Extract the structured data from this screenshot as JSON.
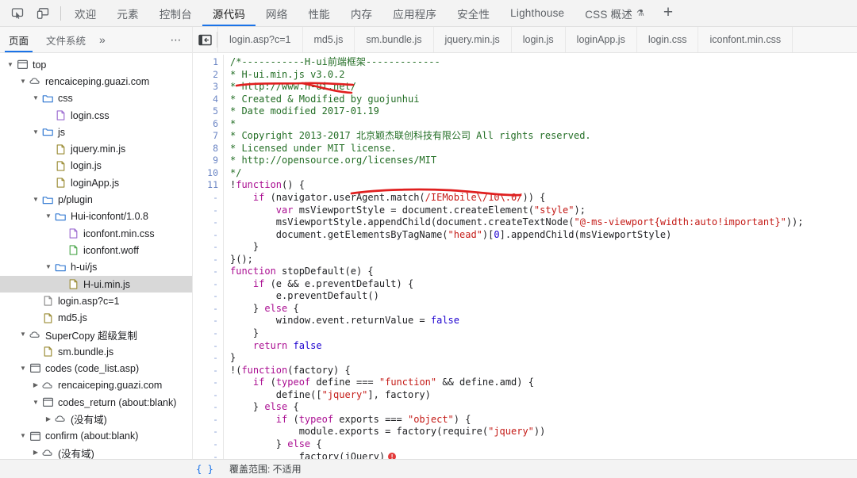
{
  "topbar": {
    "icons": [
      {
        "name": "inspect-element-icon",
        "title": "检查"
      },
      {
        "name": "device-toolbar-icon",
        "title": "设备工具栏"
      }
    ],
    "tabs": [
      {
        "label": "欢迎",
        "active": false,
        "flask": false
      },
      {
        "label": "元素",
        "active": false,
        "flask": false
      },
      {
        "label": "控制台",
        "active": false,
        "flask": false
      },
      {
        "label": "源代码",
        "active": true,
        "flask": false
      },
      {
        "label": "网络",
        "active": false,
        "flask": false
      },
      {
        "label": "性能",
        "active": false,
        "flask": false
      },
      {
        "label": "内存",
        "active": false,
        "flask": false
      },
      {
        "label": "应用程序",
        "active": false,
        "flask": false
      },
      {
        "label": "安全性",
        "active": false,
        "flask": false
      },
      {
        "label": "Lighthouse",
        "active": false,
        "flask": false
      },
      {
        "label": "CSS 概述",
        "active": false,
        "flask": true
      }
    ],
    "add_tab_label": "+"
  },
  "navigator": {
    "tabs": [
      {
        "label": "页面",
        "active": true
      },
      {
        "label": "文件系统",
        "active": false
      }
    ],
    "more_tabs_label": "»",
    "options_label": "⋯",
    "tree": [
      {
        "depth": 0,
        "twisty": "down",
        "icon": "frame-icon",
        "label": "top",
        "selected": false
      },
      {
        "depth": 1,
        "twisty": "down",
        "icon": "cloud-icon",
        "label": "rencaiceping.guazi.com",
        "selected": false
      },
      {
        "depth": 2,
        "twisty": "down",
        "icon": "folder-icon",
        "label": "css",
        "selected": false
      },
      {
        "depth": 3,
        "twisty": "none",
        "icon": "file-css-icon",
        "label": "login.css",
        "selected": false
      },
      {
        "depth": 2,
        "twisty": "down",
        "icon": "folder-icon",
        "label": "js",
        "selected": false
      },
      {
        "depth": 3,
        "twisty": "none",
        "icon": "file-js-icon",
        "label": "jquery.min.js",
        "selected": false
      },
      {
        "depth": 3,
        "twisty": "none",
        "icon": "file-js-icon",
        "label": "login.js",
        "selected": false
      },
      {
        "depth": 3,
        "twisty": "none",
        "icon": "file-js-icon",
        "label": "loginApp.js",
        "selected": false
      },
      {
        "depth": 2,
        "twisty": "down",
        "icon": "folder-icon",
        "label": "p/plugin",
        "selected": false
      },
      {
        "depth": 3,
        "twisty": "down",
        "icon": "folder-icon",
        "label": "Hui-iconfont/1.0.8",
        "selected": false
      },
      {
        "depth": 4,
        "twisty": "none",
        "icon": "file-css-icon",
        "label": "iconfont.min.css",
        "selected": false
      },
      {
        "depth": 4,
        "twisty": "none",
        "icon": "file-font-icon",
        "label": "iconfont.woff",
        "selected": false
      },
      {
        "depth": 3,
        "twisty": "down",
        "icon": "folder-icon",
        "label": "h-ui/js",
        "selected": false
      },
      {
        "depth": 4,
        "twisty": "none",
        "icon": "file-js-icon",
        "label": "H-ui.min.js",
        "selected": true
      },
      {
        "depth": 2,
        "twisty": "none",
        "icon": "file-doc-icon",
        "label": "login.asp?c=1",
        "selected": false
      },
      {
        "depth": 2,
        "twisty": "none",
        "icon": "file-js-icon",
        "label": "md5.js",
        "selected": false
      },
      {
        "depth": 1,
        "twisty": "down",
        "icon": "cloud-icon",
        "label": "SuperCopy 超级复制",
        "selected": false
      },
      {
        "depth": 2,
        "twisty": "none",
        "icon": "file-js-icon",
        "label": "sm.bundle.js",
        "selected": false
      },
      {
        "depth": 1,
        "twisty": "down",
        "icon": "frame-icon",
        "label": "codes (code_list.asp)",
        "selected": false
      },
      {
        "depth": 2,
        "twisty": "right",
        "icon": "cloud-icon",
        "label": "rencaiceping.guazi.com",
        "selected": false
      },
      {
        "depth": 2,
        "twisty": "down",
        "icon": "frame-icon",
        "label": "codes_return (about:blank)",
        "selected": false
      },
      {
        "depth": 3,
        "twisty": "right",
        "icon": "cloud-icon",
        "label": "(没有域)",
        "selected": false
      },
      {
        "depth": 1,
        "twisty": "down",
        "icon": "frame-icon",
        "label": "confirm (about:blank)",
        "selected": false
      },
      {
        "depth": 2,
        "twisty": "right",
        "icon": "cloud-icon",
        "label": "(没有域)",
        "selected": false
      }
    ]
  },
  "editor": {
    "panel_toggle_name": "show-navigator-button",
    "tabs": [
      {
        "label": "login.asp?c=1",
        "active": false
      },
      {
        "label": "md5.js",
        "active": false
      },
      {
        "label": "sm.bundle.js",
        "active": false
      },
      {
        "label": "jquery.min.js",
        "active": false
      },
      {
        "label": "login.js",
        "active": false
      },
      {
        "label": "loginApp.js",
        "active": false
      },
      {
        "label": "login.css",
        "active": false
      },
      {
        "label": "iconfont.min.css",
        "active": false
      }
    ],
    "line_numbers": [
      "1",
      "2",
      "3",
      "4",
      "5",
      "6",
      "7",
      "8",
      "9",
      "10",
      "11",
      "-",
      "-",
      "-",
      "-",
      "-",
      "-",
      "-",
      "-",
      "-",
      "-",
      "-",
      "-",
      "-",
      "-",
      "-",
      "-",
      "-",
      "-",
      "-",
      "-",
      "-",
      "-",
      "-"
    ],
    "lines": [
      {
        "tokens": [
          {
            "t": "/*-----------H-ui前端框架-------------",
            "c": "c-com"
          }
        ]
      },
      {
        "tokens": [
          {
            "t": "* H-ui.min.js v3.0.2",
            "c": "c-com"
          }
        ]
      },
      {
        "tokens": [
          {
            "t": "* http://www.h-ui.net/",
            "c": "c-com"
          }
        ]
      },
      {
        "tokens": [
          {
            "t": "* Created & Modified by guojunhui",
            "c": "c-com"
          }
        ]
      },
      {
        "tokens": [
          {
            "t": "* Date modified 2017-01.19",
            "c": "c-com"
          }
        ]
      },
      {
        "tokens": [
          {
            "t": "*",
            "c": "c-com"
          }
        ]
      },
      {
        "tokens": [
          {
            "t": "* Copyright 2013-2017 北京颖杰联创科技有限公司 All rights reserved.",
            "c": "c-com"
          }
        ]
      },
      {
        "tokens": [
          {
            "t": "* Licensed under MIT license.",
            "c": "c-com"
          }
        ]
      },
      {
        "tokens": [
          {
            "t": "* http://opensource.org/licenses/MIT",
            "c": "c-com"
          }
        ]
      },
      {
        "tokens": [
          {
            "t": "*/",
            "c": "c-com"
          }
        ]
      },
      {
        "tokens": [
          {
            "t": "!",
            "c": "c-plain"
          },
          {
            "t": "function",
            "c": "c-kw"
          },
          {
            "t": "() {",
            "c": "c-plain"
          }
        ]
      },
      {
        "tokens": [
          {
            "t": "    ",
            "c": "c-plain"
          },
          {
            "t": "if",
            "c": "c-kw"
          },
          {
            "t": " (navigator.userAgent.match(",
            "c": "c-plain"
          },
          {
            "t": "/IEMobile\\/10\\.0/",
            "c": "c-re"
          },
          {
            "t": ")) {",
            "c": "c-plain"
          }
        ]
      },
      {
        "tokens": [
          {
            "t": "        ",
            "c": "c-plain"
          },
          {
            "t": "var",
            "c": "c-kw"
          },
          {
            "t": " msViewportStyle = document.createElement(",
            "c": "c-plain"
          },
          {
            "t": "\"style\"",
            "c": "c-str"
          },
          {
            "t": ");",
            "c": "c-plain"
          }
        ]
      },
      {
        "tokens": [
          {
            "t": "        msViewportStyle.appendChild(document.createTextNode(",
            "c": "c-plain"
          },
          {
            "t": "\"@-ms-viewport{width:auto!important}\"",
            "c": "c-str"
          },
          {
            "t": "));",
            "c": "c-plain"
          }
        ]
      },
      {
        "tokens": [
          {
            "t": "        document.getElementsByTagName(",
            "c": "c-plain"
          },
          {
            "t": "\"head\"",
            "c": "c-str"
          },
          {
            "t": ")[",
            "c": "c-plain"
          },
          {
            "t": "0",
            "c": "c-num"
          },
          {
            "t": "].appendChild(msViewportStyle)",
            "c": "c-plain"
          }
        ]
      },
      {
        "tokens": [
          {
            "t": "    }",
            "c": "c-plain"
          }
        ]
      },
      {
        "tokens": [
          {
            "t": "}();",
            "c": "c-plain"
          }
        ]
      },
      {
        "tokens": [
          {
            "t": "function",
            "c": "c-kw"
          },
          {
            "t": " stopDefault(e) {",
            "c": "c-plain"
          }
        ]
      },
      {
        "tokens": [
          {
            "t": "    ",
            "c": "c-plain"
          },
          {
            "t": "if",
            "c": "c-kw"
          },
          {
            "t": " (e && e.preventDefault) {",
            "c": "c-plain"
          }
        ]
      },
      {
        "tokens": [
          {
            "t": "        e.preventDefault()",
            "c": "c-plain"
          }
        ]
      },
      {
        "tokens": [
          {
            "t": "    } ",
            "c": "c-plain"
          },
          {
            "t": "else",
            "c": "c-kw"
          },
          {
            "t": " {",
            "c": "c-plain"
          }
        ]
      },
      {
        "tokens": [
          {
            "t": "        window.event.returnValue = ",
            "c": "c-plain"
          },
          {
            "t": "false",
            "c": "c-num"
          }
        ]
      },
      {
        "tokens": [
          {
            "t": "    }",
            "c": "c-plain"
          }
        ]
      },
      {
        "tokens": [
          {
            "t": "    ",
            "c": "c-plain"
          },
          {
            "t": "return",
            "c": "c-kw"
          },
          {
            "t": " ",
            "c": "c-plain"
          },
          {
            "t": "false",
            "c": "c-num"
          }
        ]
      },
      {
        "tokens": [
          {
            "t": "}",
            "c": "c-plain"
          }
        ]
      },
      {
        "tokens": [
          {
            "t": "!(",
            "c": "c-plain"
          },
          {
            "t": "function",
            "c": "c-kw"
          },
          {
            "t": "(factory) {",
            "c": "c-plain"
          }
        ]
      },
      {
        "tokens": [
          {
            "t": "    ",
            "c": "c-plain"
          },
          {
            "t": "if",
            "c": "c-kw"
          },
          {
            "t": " (",
            "c": "c-plain"
          },
          {
            "t": "typeof",
            "c": "c-kw"
          },
          {
            "t": " define === ",
            "c": "c-plain"
          },
          {
            "t": "\"function\"",
            "c": "c-str"
          },
          {
            "t": " && define.amd) {",
            "c": "c-plain"
          }
        ]
      },
      {
        "tokens": [
          {
            "t": "        define([",
            "c": "c-plain"
          },
          {
            "t": "\"jquery\"",
            "c": "c-str"
          },
          {
            "t": "], factory)",
            "c": "c-plain"
          }
        ]
      },
      {
        "tokens": [
          {
            "t": "    } ",
            "c": "c-plain"
          },
          {
            "t": "else",
            "c": "c-kw"
          },
          {
            "t": " {",
            "c": "c-plain"
          }
        ]
      },
      {
        "tokens": [
          {
            "t": "        ",
            "c": "c-plain"
          },
          {
            "t": "if",
            "c": "c-kw"
          },
          {
            "t": " (",
            "c": "c-plain"
          },
          {
            "t": "typeof",
            "c": "c-kw"
          },
          {
            "t": " exports === ",
            "c": "c-plain"
          },
          {
            "t": "\"object\"",
            "c": "c-str"
          },
          {
            "t": ") {",
            "c": "c-plain"
          }
        ]
      },
      {
        "tokens": [
          {
            "t": "            module.exports = factory(require(",
            "c": "c-plain"
          },
          {
            "t": "\"jquery\"",
            "c": "c-str"
          },
          {
            "t": "))",
            "c": "c-plain"
          }
        ]
      },
      {
        "tokens": [
          {
            "t": "        } ",
            "c": "c-plain"
          },
          {
            "t": "else",
            "c": "c-kw"
          },
          {
            "t": " {",
            "c": "c-plain"
          }
        ]
      },
      {
        "tokens": [
          {
            "t": "            factory(jQuery)",
            "c": "c-plain"
          },
          {
            "t": "__ERRDOT__",
            "c": "c-plain"
          }
        ]
      }
    ],
    "annotations": {
      "color": "#e01f1f",
      "marks": [
        {
          "name": "red-underline-url",
          "target": "http://www.h-ui.net/"
        },
        {
          "name": "red-underline-company",
          "target": "北京颖杰联创科技有限公司"
        }
      ]
    }
  },
  "statusbar": {
    "format_button_label": "{ }",
    "coverage_text": "覆盖范围: 不适用"
  },
  "colors": {
    "accent": "#1a73e8",
    "comment_green": "#236e25",
    "keyword_purple": "#aa0d91",
    "string_red": "#c41a16",
    "annotation_red": "#e01f1f",
    "selection_gray": "#d8d8d8"
  }
}
